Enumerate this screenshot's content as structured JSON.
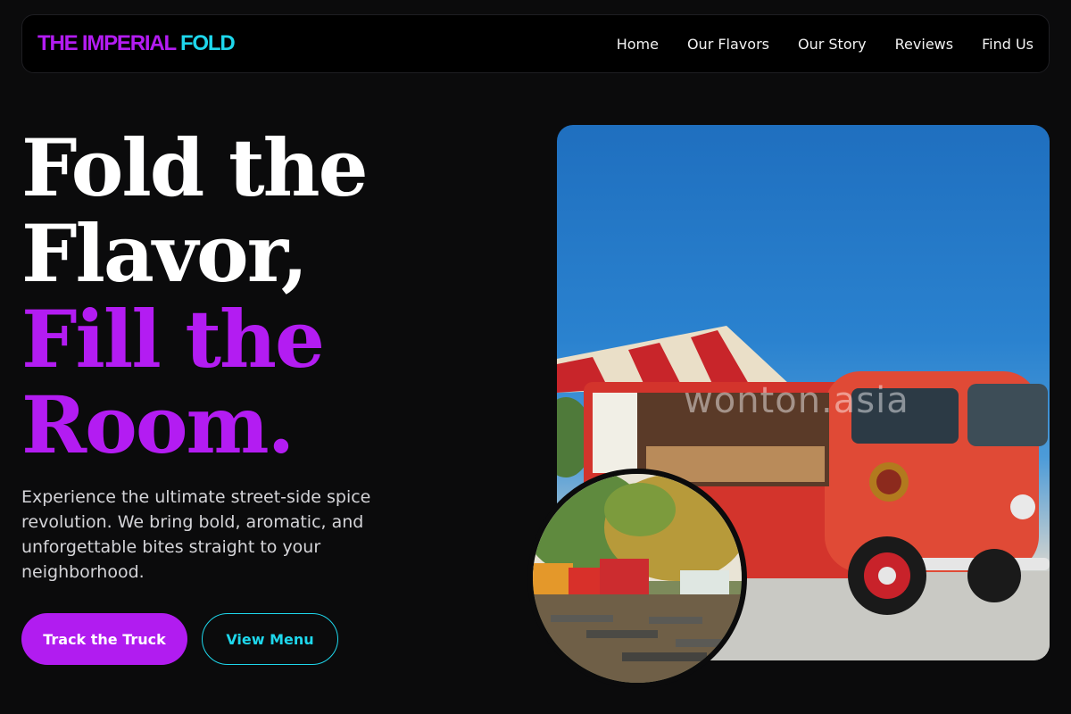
{
  "brand": {
    "part1": "THE IMPERIAL",
    "part2": "FOLD"
  },
  "nav": {
    "items": [
      {
        "label": "Home"
      },
      {
        "label": "Our Flavors"
      },
      {
        "label": "Our Story"
      },
      {
        "label": "Reviews"
      },
      {
        "label": "Find Us"
      }
    ]
  },
  "hero": {
    "title_lines": [
      "Fold the",
      "Flavor,",
      "Fill the",
      "Room."
    ],
    "description": "Experience the ultimate street-side spice revolution. We bring bold, aromatic, and unforgettable bites straight to your neighborhood.",
    "primary_cta": "Track the Truck",
    "secondary_cta": "View Menu"
  },
  "media": {
    "main_photo_watermark": "wonton.asia"
  },
  "colors": {
    "background": "#0b0b0c",
    "accent_purple": "#b31cf2",
    "accent_cyan": "#1ed7ec"
  }
}
